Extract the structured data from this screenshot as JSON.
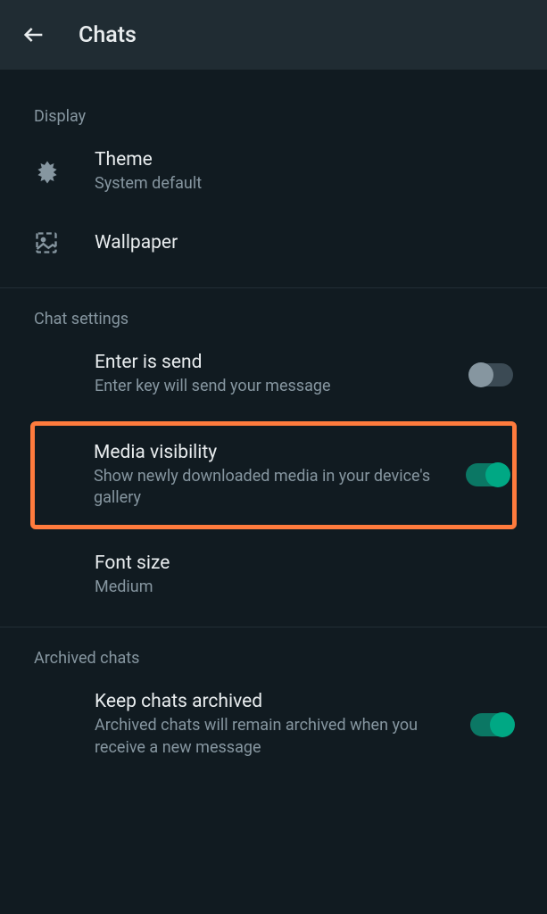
{
  "header": {
    "title": "Chats"
  },
  "sections": {
    "display": {
      "header": "Display",
      "theme": {
        "title": "Theme",
        "subtitle": "System default"
      },
      "wallpaper": {
        "title": "Wallpaper"
      }
    },
    "chat_settings": {
      "header": "Chat settings",
      "enter_is_send": {
        "title": "Enter is send",
        "subtitle": "Enter key will send your message",
        "enabled": false
      },
      "media_visibility": {
        "title": "Media visibility",
        "subtitle": "Show newly downloaded media in your device's gallery",
        "enabled": true
      },
      "font_size": {
        "title": "Font size",
        "subtitle": "Medium"
      }
    },
    "archived_chats": {
      "header": "Archived chats",
      "keep_archived": {
        "title": "Keep chats archived",
        "subtitle": "Archived chats will remain archived when you receive a new message",
        "enabled": true
      }
    }
  }
}
